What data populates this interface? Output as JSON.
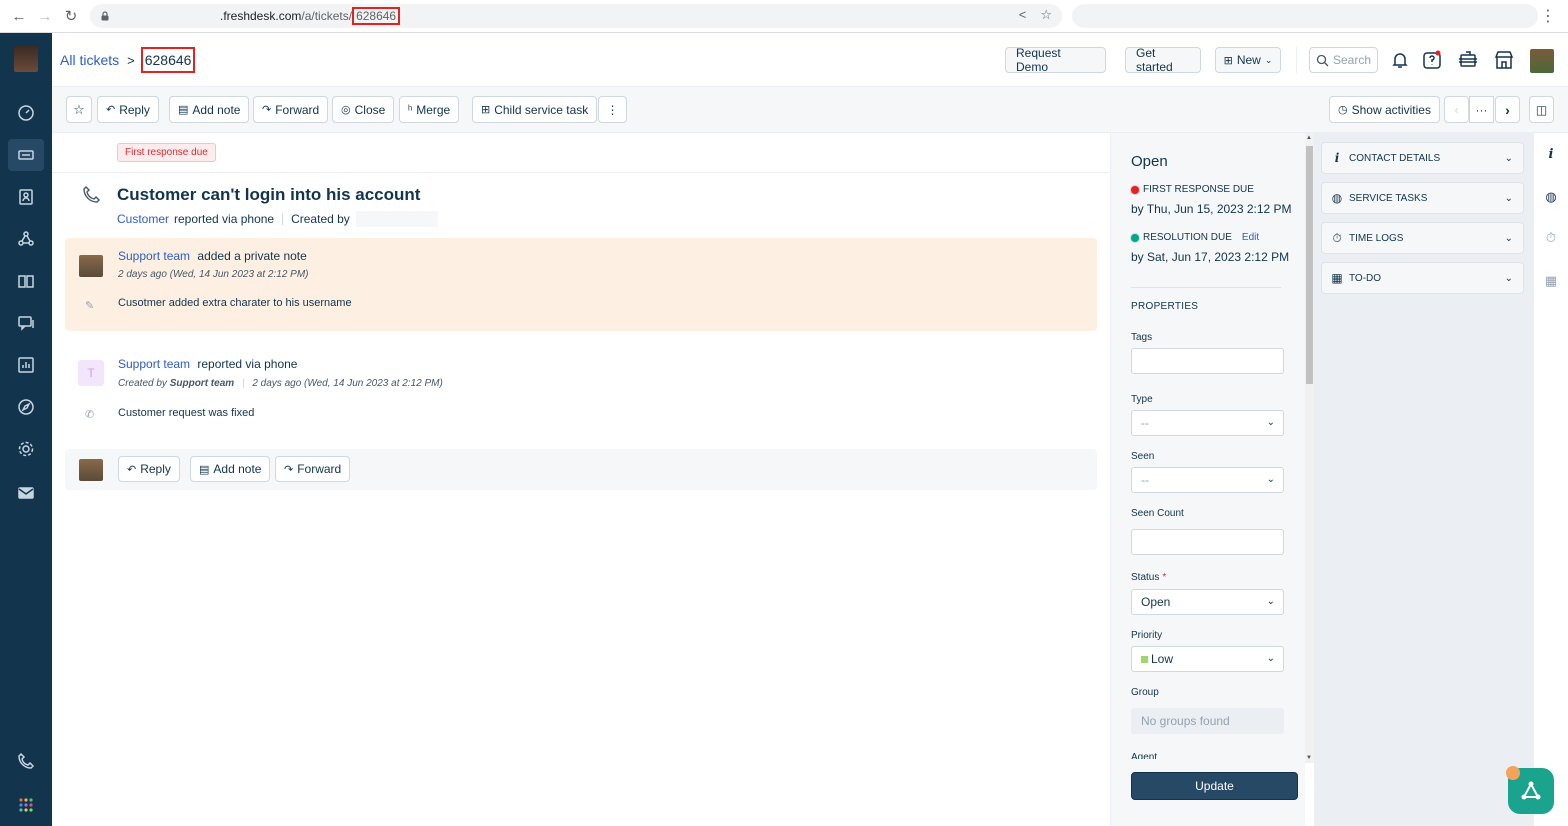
{
  "browser": {
    "url_domain": ".freshdesk.com",
    "url_path": "/a/tickets/",
    "url_id": "628646"
  },
  "breadcrumb": {
    "parent": "All tickets",
    "separator": ">",
    "current": "628646"
  },
  "header": {
    "request_demo": "Request Demo",
    "get_started": "Get started",
    "new_label": "New",
    "search_placeholder": "Search"
  },
  "toolbar": {
    "reply": "Reply",
    "add_note": "Add note",
    "forward": "Forward",
    "close": "Close",
    "merge": "Merge",
    "child_task": "Child service task",
    "more": "⋮",
    "show_activities": "Show activities",
    "pager_more": "···"
  },
  "ticket": {
    "due_badge": "First response due",
    "title": "Customer can't login into his account",
    "requester": "Customer",
    "reported_via": "reported via phone",
    "created_by": "Created by"
  },
  "conversations": [
    {
      "author": "Support team",
      "action": "added a private note",
      "time": "2 days ago (Wed, 14 Jun 2023 at 2:12 PM)",
      "body": "Cusotmer added extra charater to his username"
    },
    {
      "avatar_letter": "T",
      "author": "Support team",
      "action": "reported via phone",
      "created_by_prefix": "Created by",
      "created_by_name": "Support team",
      "time": "2 days ago (Wed, 14 Jun 2023 at 2:12 PM)",
      "body": "Customer request was fixed"
    }
  ],
  "reply_bar": {
    "reply": "Reply",
    "add_note": "Add note",
    "forward": "Forward"
  },
  "properties": {
    "status_heading": "Open",
    "first_response_label": "FIRST RESPONSE DUE",
    "first_response_time": "by Thu, Jun 15, 2023 2:12 PM",
    "resolution_label": "RESOLUTION DUE",
    "resolution_edit": "Edit",
    "resolution_time": "by Sat, Jun 17, 2023 2:12 PM",
    "section_title": "PROPERTIES",
    "tags_label": "Tags",
    "type_label": "Type",
    "type_value": "--",
    "seen_label": "Seen",
    "seen_value": "--",
    "seen_count_label": "Seen Count",
    "status_label": "Status",
    "status_required": "*",
    "status_value": "Open",
    "priority_label": "Priority",
    "priority_value": "Low",
    "priority_color": "#a0d76a",
    "group_label": "Group",
    "group_value": "No groups found",
    "agent_label": "Agent",
    "update_button": "Update"
  },
  "widgets": {
    "contact_details": "CONTACT DETAILS",
    "service_tasks": "SERVICE TASKS",
    "time_logs": "TIME LOGS",
    "todo": "TO-DO"
  },
  "colors": {
    "sidebar": "#12344d",
    "link": "#2c5cc5",
    "note_bg": "#fdf0e3",
    "fab": "#1aa38d",
    "danger": "#d72d30",
    "success": "#00a886"
  }
}
